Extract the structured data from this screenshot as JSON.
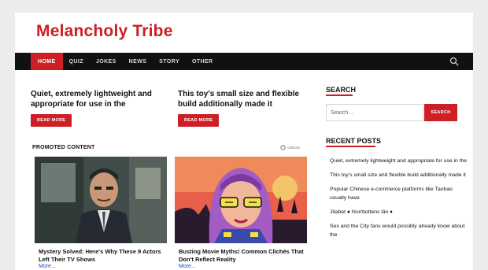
{
  "site": {
    "title": "Melancholy Tribe"
  },
  "nav": {
    "items": [
      {
        "label": "HOME",
        "active": true
      },
      {
        "label": "QUIZ",
        "active": false
      },
      {
        "label": "JOKES",
        "active": false
      },
      {
        "label": "NEWS",
        "active": false
      },
      {
        "label": "STORY",
        "active": false
      },
      {
        "label": "OTHER",
        "active": false
      }
    ],
    "search_icon": "search-icon"
  },
  "posts": [
    {
      "title": "Quiet, extremely lightweight and appropriate for use in the",
      "button": "READ MORE"
    },
    {
      "title": "This toy's small size and flexible build additionally made it",
      "button": "READ MORE"
    }
  ],
  "promoted": {
    "heading": "PROMOTED CONTENT",
    "provider": "outbrain",
    "cards": [
      {
        "title": "Mystery Solved: Here's Why These 9 Actors Left Their TV Shows",
        "more": "More..."
      },
      {
        "title": "Busting Movie Myths! Common Clichés That Don't Reflect Reality",
        "more": "More..."
      }
    ]
  },
  "sidebar": {
    "search": {
      "title": "SEARCH",
      "placeholder": "Search ...",
      "button": "SEARCH"
    },
    "recent": {
      "title": "RECENT POSTS",
      "items": [
        "Quiet, extremely lightweight and appropriate for use in the",
        "This toy's small size and flexible build additionally made it",
        "Popular Chinese e-commerce platforms like Taobao usually have",
        "Jitabet ● Norrbottens län ♦",
        "Sex and the City fans would possibly already know about the"
      ]
    }
  },
  "colors": {
    "accent": "#cc2026",
    "nav_bg": "#111111",
    "link": "#1a4fb8"
  }
}
